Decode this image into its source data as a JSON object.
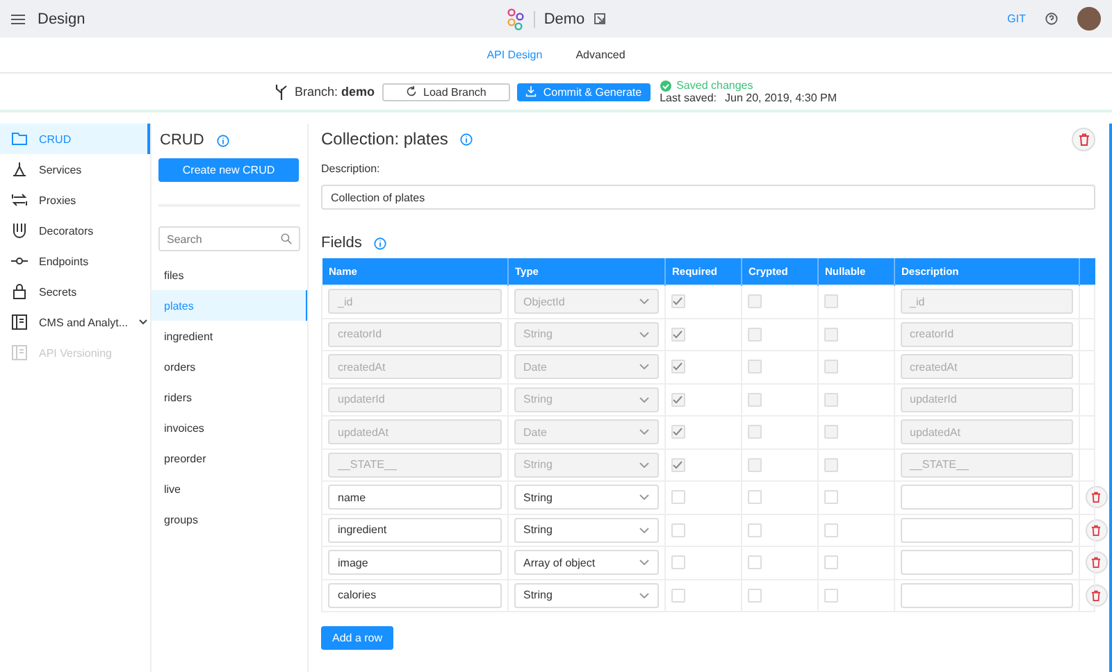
{
  "app_title": "Design",
  "project": {
    "name": "Demo"
  },
  "header_links": {
    "git": "GIT"
  },
  "tabs": [
    {
      "label": "API Design",
      "selected": true
    },
    {
      "label": "Advanced",
      "selected": false
    }
  ],
  "branch": {
    "label": "Branch:",
    "name": "demo",
    "load_button": "Load Branch",
    "commit_button": "Commit & Generate",
    "status": "Saved changes",
    "last_saved_label": "Last saved:",
    "last_saved": "Jun 20, 2019, 4:30 PM"
  },
  "nav": [
    {
      "label": "CRUD",
      "selected": true,
      "disabled": false,
      "expandable": false
    },
    {
      "label": "Services",
      "selected": false,
      "disabled": false,
      "expandable": false
    },
    {
      "label": "Proxies",
      "selected": false,
      "disabled": false,
      "expandable": false
    },
    {
      "label": "Decorators",
      "selected": false,
      "disabled": false,
      "expandable": false
    },
    {
      "label": "Endpoints",
      "selected": false,
      "disabled": false,
      "expandable": false
    },
    {
      "label": "Secrets",
      "selected": false,
      "disabled": false,
      "expandable": false
    },
    {
      "label": "CMS and Analyt...",
      "selected": false,
      "disabled": false,
      "expandable": true
    },
    {
      "label": "API Versioning",
      "selected": false,
      "disabled": true,
      "expandable": false
    }
  ],
  "crud": {
    "title": "CRUD",
    "create_button": "Create new CRUD",
    "search_placeholder": "Search",
    "items": [
      {
        "label": "files",
        "selected": false
      },
      {
        "label": "plates",
        "selected": true
      },
      {
        "label": "ingredient",
        "selected": false
      },
      {
        "label": "orders",
        "selected": false
      },
      {
        "label": "riders",
        "selected": false
      },
      {
        "label": "invoices",
        "selected": false
      },
      {
        "label": "preorder",
        "selected": false
      },
      {
        "label": "live",
        "selected": false
      },
      {
        "label": "groups",
        "selected": false
      }
    ]
  },
  "collection": {
    "title": "Collection: plates",
    "description_label": "Description:",
    "description": "Collection of plates",
    "fields_title": "Fields",
    "add_row_button": "Add a row"
  },
  "table": {
    "columns": [
      "Name",
      "Type",
      "Required",
      "Crypted",
      "Nullable",
      "Description"
    ],
    "rows": [
      {
        "name": "_id",
        "type": "ObjectId",
        "required": true,
        "crypted": false,
        "nullable": false,
        "description": "_id",
        "locked": true
      },
      {
        "name": "creatorId",
        "type": "String",
        "required": true,
        "crypted": false,
        "nullable": false,
        "description": "creatorId",
        "locked": true
      },
      {
        "name": "createdAt",
        "type": "Date",
        "required": true,
        "crypted": false,
        "nullable": false,
        "description": "createdAt",
        "locked": true
      },
      {
        "name": "updaterId",
        "type": "String",
        "required": true,
        "crypted": false,
        "nullable": false,
        "description": "updaterId",
        "locked": true
      },
      {
        "name": "updatedAt",
        "type": "Date",
        "required": true,
        "crypted": false,
        "nullable": false,
        "description": "updatedAt",
        "locked": true
      },
      {
        "name": "__STATE__",
        "type": "String",
        "required": true,
        "crypted": false,
        "nullable": false,
        "description": "__STATE__",
        "locked": true
      },
      {
        "name": "name",
        "type": "String",
        "required": false,
        "crypted": false,
        "nullable": false,
        "description": "",
        "locked": false
      },
      {
        "name": "ingredient",
        "type": "String",
        "required": false,
        "crypted": false,
        "nullable": false,
        "description": "",
        "locked": false
      },
      {
        "name": "image",
        "type": "Array of object",
        "required": false,
        "crypted": false,
        "nullable": false,
        "description": "",
        "locked": false
      },
      {
        "name": "calories",
        "type": "String",
        "required": false,
        "crypted": false,
        "nullable": false,
        "description": "",
        "locked": false
      }
    ]
  }
}
